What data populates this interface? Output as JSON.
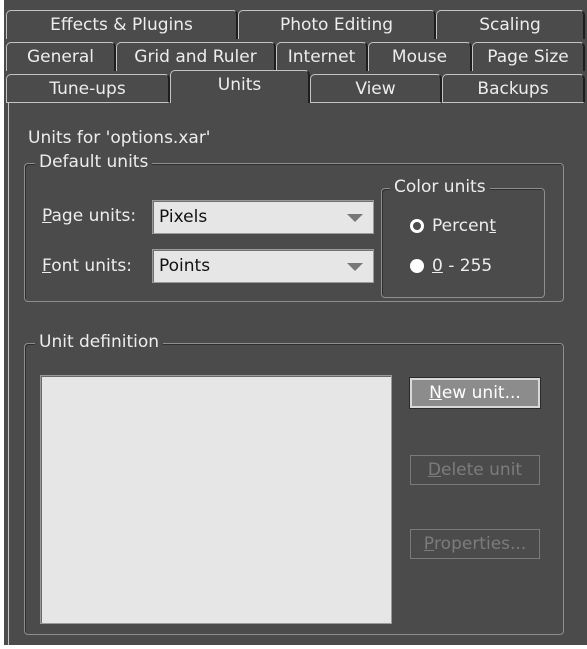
{
  "tabs": {
    "row1": [
      "Effects & Plugins",
      "Photo Editing",
      "Scaling"
    ],
    "row2": [
      "General",
      "Grid and Ruler",
      "Internet",
      "Mouse",
      "Page Size"
    ],
    "row3": [
      "Tune-ups",
      "Units",
      "View",
      "Backups"
    ],
    "active": "Units"
  },
  "header": {
    "units_for": "Units for 'options.xar'"
  },
  "default_units": {
    "title": "Default units",
    "page_units_label_mnemonic": "P",
    "page_units_label_rest": "age units:",
    "page_units_value": "Pixels",
    "font_units_label_mnemonic": "F",
    "font_units_label_rest": "ont units:",
    "font_units_value": "Points"
  },
  "color_units": {
    "title": "Color units",
    "percent_label_pre": "Percen",
    "percent_label_mnemonic": "t",
    "percent_checked": true,
    "range_label_mnemonic": "0",
    "range_label_rest": " - 255",
    "range_checked": false
  },
  "unit_definition": {
    "title": "Unit definition",
    "items": [],
    "new_unit_mnemonic": "N",
    "new_unit_rest": "ew unit...",
    "delete_unit_mnemonic": "D",
    "delete_unit_rest": "elete unit",
    "properties_mnemonic": "P",
    "properties_rest": "roperties..."
  },
  "colors": {
    "panel_bg": "#4b4b4b",
    "field_bg": "#e6e6e6",
    "text": "#ededed",
    "disabled_text": "#7c7c7c"
  }
}
